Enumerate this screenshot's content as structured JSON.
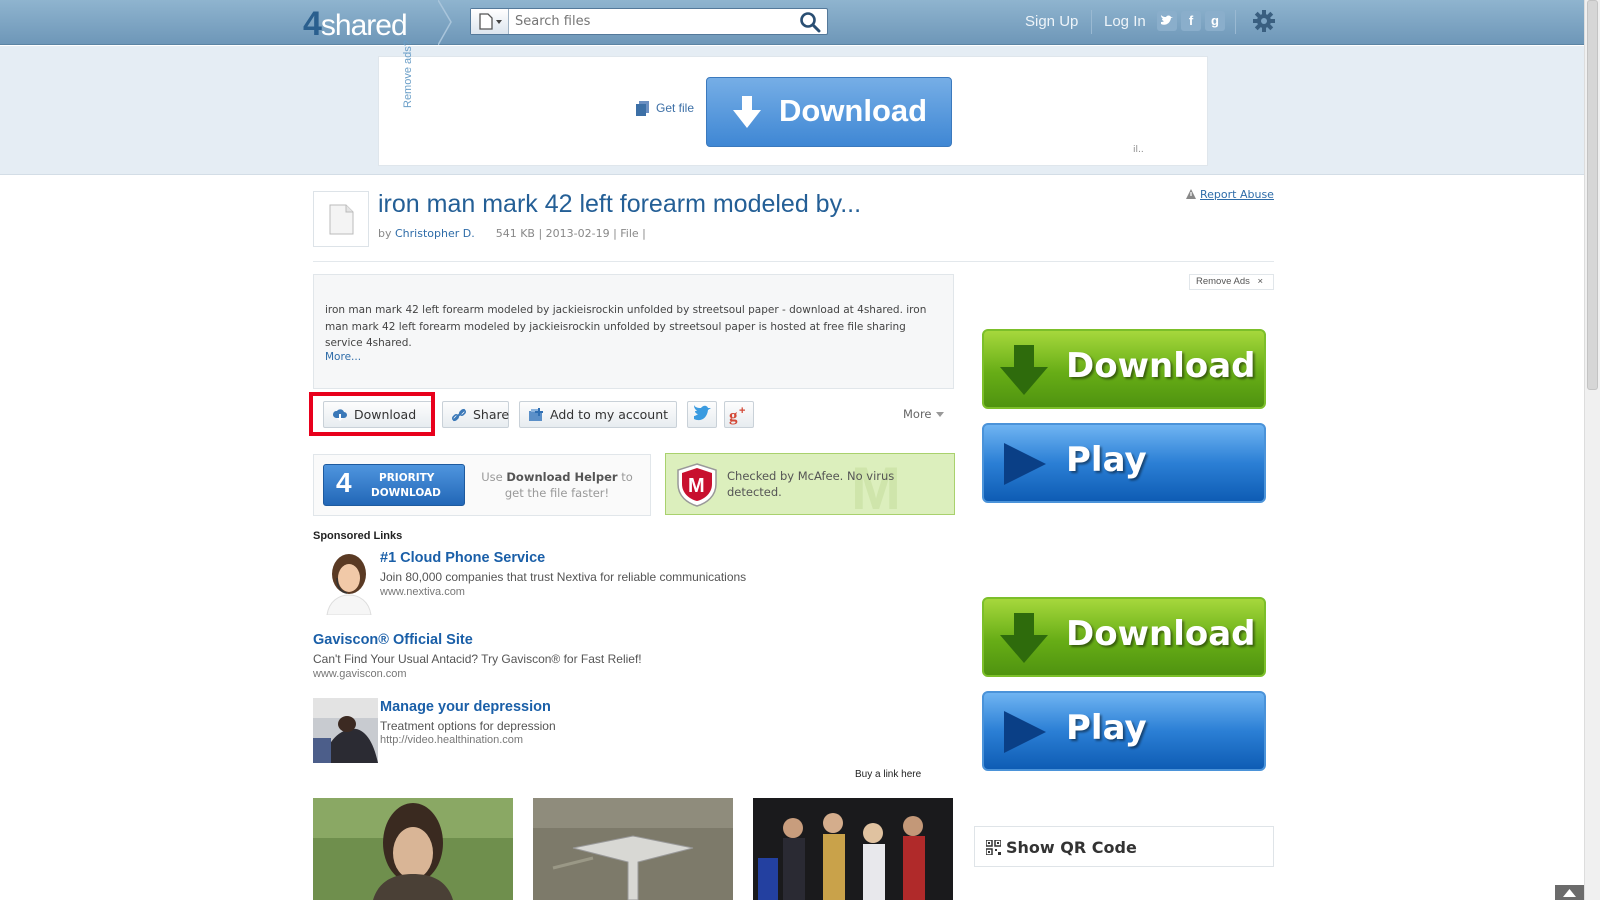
{
  "header": {
    "logo_number": "4",
    "logo_text": "shared",
    "search_placeholder": "Search files",
    "signup": "Sign Up",
    "login": "Log In",
    "social": [
      "twitter-icon",
      "facebook-icon",
      "google-icon"
    ],
    "facebook_glyph": "f",
    "google_glyph": "g"
  },
  "ad_top": {
    "remove_ads": "Remove ads?",
    "get_file": "Get file",
    "download_label": "Download",
    "ad_tag": "il.."
  },
  "file": {
    "title": "iron man mark 42 left forearm modeled by...",
    "by": "by",
    "author": "Christopher D.",
    "meta": "541 KB | 2013-02-19 | File |",
    "report_abuse": "Report Abuse"
  },
  "description": {
    "text": "iron man mark 42 left forearm modeled by jackieisrockin unfolded by streetsoul paper - download at 4shared. iron man mark 42 left forearm modeled by jackieisrockin unfolded by streetsoul paper is hosted at free file sharing service 4shared.",
    "more": "More..."
  },
  "actions": {
    "download": "Download",
    "share": "Share",
    "add_to_account": "Add to my account",
    "more": "More"
  },
  "priority": {
    "number": "4",
    "line1": "PRIORITY",
    "line2": "DOWNLOAD",
    "helper_pre": "Use",
    "helper_bold": "Download Helper",
    "helper_post": "to get the file faster!"
  },
  "mcafee": {
    "text": "Checked by McAfee. No virus detected.",
    "shield_letter": "M",
    "watermark": "M"
  },
  "sponsored": {
    "title": "Sponsored Links",
    "items": [
      {
        "head": "#1 Cloud Phone Service",
        "desc": "Join 80,000 companies that trust Nextiva for reliable communications",
        "url": "www.nextiva.com"
      },
      {
        "head": "Gaviscon® Official Site",
        "desc": "Can't Find Your Usual Antacid? Try Gaviscon® for Fast Relief!",
        "url": "www.gaviscon.com"
      },
      {
        "head": "Manage your depression",
        "desc": "Treatment options for depression",
        "url": "http://video.healthination.com"
      }
    ],
    "buy_link": "Buy a link here"
  },
  "right": {
    "remove_ads": "Remove Ads",
    "remove_ads_x": "×",
    "download": "Download",
    "play": "Play",
    "qr": "Show QR Code"
  },
  "colors": {
    "header_bg": "#7ea5c4",
    "link_blue": "#2e6ca8",
    "highlight_red": "#e8001c",
    "green_btn": "#67ad16",
    "blue_btn": "#2b7fd5"
  }
}
